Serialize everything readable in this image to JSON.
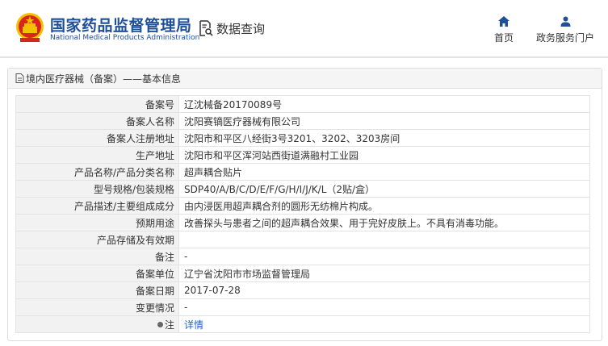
{
  "header": {
    "site_name": "国家药品监督管理局",
    "site_name_en": "National Medical Products Administration",
    "query_label": "数据查询",
    "nav": {
      "home": "首页",
      "portal": "政务服务门户"
    }
  },
  "panel": {
    "title": "境内医疗器械（备案）——基本信息",
    "rows": [
      {
        "label": "备案号",
        "value": "辽沈械备20170089号"
      },
      {
        "label": "备案人名称",
        "value": "沈阳赛镝医疗器械有限公司"
      },
      {
        "label": "备案人注册地址",
        "value": "沈阳市和平区八经街3号3201、3202、3203房间"
      },
      {
        "label": "生产地址",
        "value": "沈阳市和平区浑河站西街道满融村工业园"
      },
      {
        "label": "产品名称/产品分类名称",
        "value": "超声耦合贴片"
      },
      {
        "label": "型号规格/包装规格",
        "value": "SDP40/A/B/C/D/E/F/G/H/I/J/K/L（2贴/盒）"
      },
      {
        "label": "产品描述/主要组成成分",
        "value": "由内浸医用超声耦合剂的圆形无纺棉片构成。"
      },
      {
        "label": "预期用途",
        "value": "改善探头与患者之间的超声耦合效果、用于完好皮肤上。不具有消毒功能。"
      },
      {
        "label": "产品存储及有效期",
        "value": ""
      },
      {
        "label": "备注",
        "value": "-"
      },
      {
        "label": "备案单位",
        "value": "辽宁省沈阳市市场监督管理局"
      },
      {
        "label": "备案日期",
        "value": "2017-07-28"
      },
      {
        "label": "变更情况",
        "value": "-"
      }
    ],
    "note": {
      "label": "注",
      "link": "详情"
    }
  },
  "colors": {
    "brand": "#1e4f97",
    "link": "#1e64c8",
    "label_bg": "#f2f2f2",
    "emblem_red": "#d9261c",
    "emblem_gold": "#f2c200"
  }
}
